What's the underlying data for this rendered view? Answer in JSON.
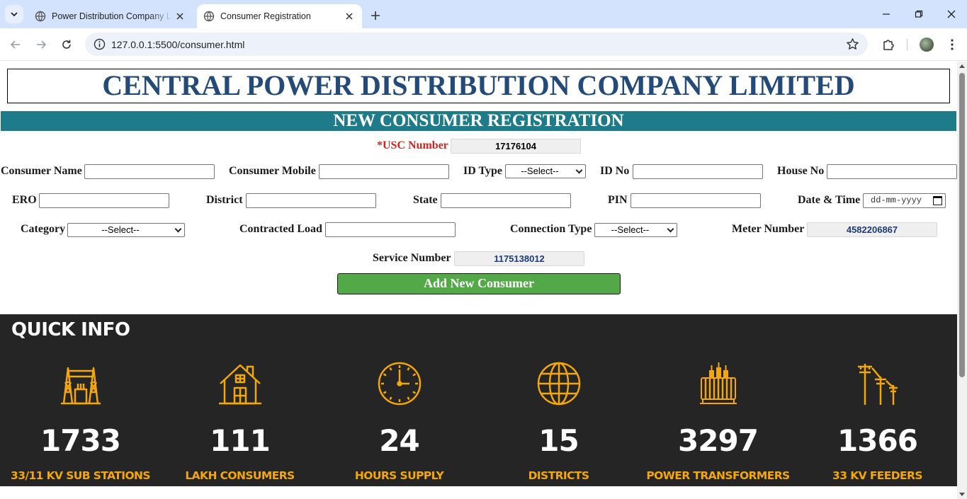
{
  "browser": {
    "tabs": [
      {
        "title": "Power Distribution Company Li",
        "active": false
      },
      {
        "title": "Consumer Registration",
        "active": true
      }
    ],
    "url": "127.0.0.1:5500/consumer.html"
  },
  "page": {
    "company_name": "CENTRAL POWER DISTRIBUTION COMPANY LIMITED",
    "form_title": "NEW CONSUMER REGISTRATION",
    "usc": {
      "label": "*USC Number",
      "value": "17176104"
    },
    "fields": {
      "consumer_name": {
        "label": "Consumer Name",
        "value": ""
      },
      "consumer_mobile": {
        "label": "Consumer Mobile",
        "value": ""
      },
      "id_type": {
        "label": "ID Type",
        "selected": "--Select--"
      },
      "id_no": {
        "label": "ID No",
        "value": ""
      },
      "house_no": {
        "label": "House No",
        "value": ""
      },
      "ero": {
        "label": "ERO",
        "value": ""
      },
      "district": {
        "label": "District",
        "value": ""
      },
      "state": {
        "label": "State",
        "value": ""
      },
      "pin": {
        "label": "PIN",
        "value": ""
      },
      "date_time": {
        "label": "Date & Time",
        "placeholder": "dd-mm-yyyy"
      },
      "category": {
        "label": "Category",
        "selected": "--Select--"
      },
      "contracted_load": {
        "label": "Contracted Load",
        "value": ""
      },
      "connection_type": {
        "label": "Connection Type",
        "selected": "--Select--"
      },
      "meter_number": {
        "label": "Meter Number",
        "value": "4582206867"
      },
      "service_number": {
        "label": "Service Number",
        "value": "1175138012"
      }
    },
    "submit_label": "Add New Consumer",
    "quick_info": {
      "title": "QUICK INFO",
      "accent_color": "#f3a70b",
      "stats": [
        {
          "icon": "substation-icon",
          "value": "1733",
          "caption": "33/11 KV SUB STATIONS"
        },
        {
          "icon": "house-icon",
          "value": "111",
          "caption": "LAKH CONSUMERS"
        },
        {
          "icon": "clock-icon",
          "value": "24",
          "caption": "HOURS SUPPLY"
        },
        {
          "icon": "globe-icon",
          "value": "15",
          "caption": "DISTRICTS"
        },
        {
          "icon": "transformer-icon",
          "value": "3297",
          "caption": "POWER TRANSFORMERS"
        },
        {
          "icon": "feeder-pole-icon",
          "value": "1366",
          "caption": "33 KV FEEDERS"
        }
      ]
    }
  }
}
